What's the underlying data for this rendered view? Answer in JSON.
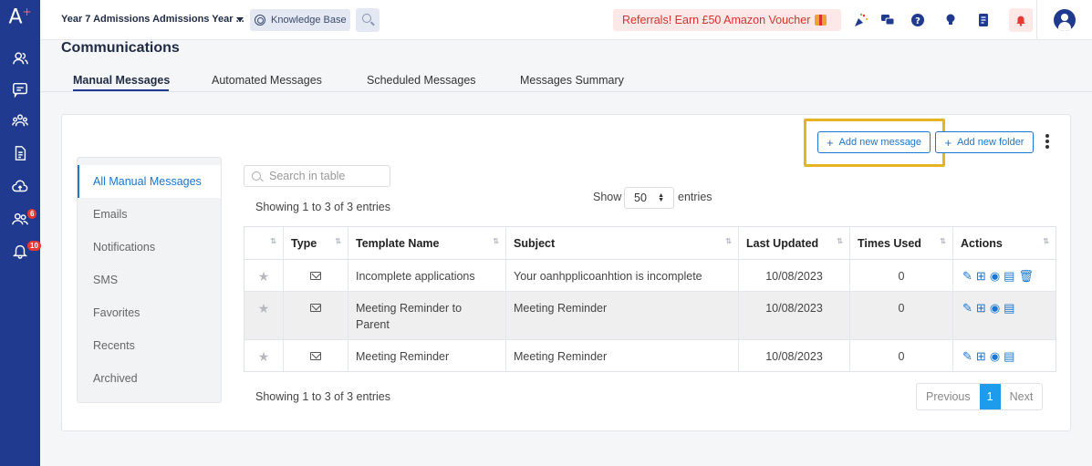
{
  "app": {
    "logo": "A",
    "logo_plus": "+"
  },
  "sidebar": {
    "icons": [
      "people-icon",
      "message-icon",
      "groups-icon",
      "document-icon",
      "cloud-upload-icon",
      "user-group-icon",
      "bell-icon"
    ],
    "badges": {
      "user_group": "6",
      "bell": "10"
    }
  },
  "topbar": {
    "year_selector": "Year 7 Admissions Admissions Year ...",
    "knowledge_base": "Knowledge Base",
    "referral": "Referrals! Earn £50 Amazon Voucher"
  },
  "page": {
    "title": "Communications"
  },
  "tabs": [
    {
      "label": "Manual Messages",
      "active": true
    },
    {
      "label": "Automated Messages"
    },
    {
      "label": "Scheduled Messages"
    },
    {
      "label": "Messages Summary"
    }
  ],
  "toolbar": {
    "add_message": "Add new message",
    "add_folder": "Add new folder",
    "plus": "+"
  },
  "side_menu": [
    "All Manual Messages",
    "Emails",
    "Notifications",
    "SMS",
    "Favorites",
    "Recents",
    "Archived"
  ],
  "table_controls": {
    "search_placeholder": "Search in table",
    "info": "Showing 1 to 3 of 3 entries",
    "show_label": "Show",
    "page_size": "50",
    "entries_label": "entries"
  },
  "table": {
    "columns": [
      "",
      "Type",
      "Template Name",
      "Subject",
      "Last Updated",
      "Times Used",
      "Actions"
    ],
    "rows": [
      {
        "template": "Incomplete applications",
        "subject": "Your oanhpplicoanhtion is incomplete",
        "updated": "10/08/2023",
        "used": "0",
        "actions": [
          "edit-icon",
          "move-to-folder-icon",
          "view-icon",
          "archive-icon",
          "delete-icon"
        ]
      },
      {
        "template": "Meeting Reminder to Parent",
        "subject": "Meeting Reminder",
        "updated": "10/08/2023",
        "used": "0",
        "actions": [
          "edit-icon",
          "move-to-folder-icon",
          "view-icon",
          "archive-icon"
        ]
      },
      {
        "template": "Meeting Reminder",
        "subject": "Meeting Reminder",
        "updated": "10/08/2023",
        "used": "0",
        "actions": [
          "edit-icon",
          "move-to-folder-icon",
          "view-icon",
          "archive-icon"
        ]
      }
    ]
  },
  "pagination": {
    "previous": "Previous",
    "current": "1",
    "next": "Next"
  },
  "colors": {
    "sidebar": "#1f3a8f",
    "accent": "#1976d2",
    "highlight": "#e6b422",
    "referral_text": "#d6332f"
  }
}
